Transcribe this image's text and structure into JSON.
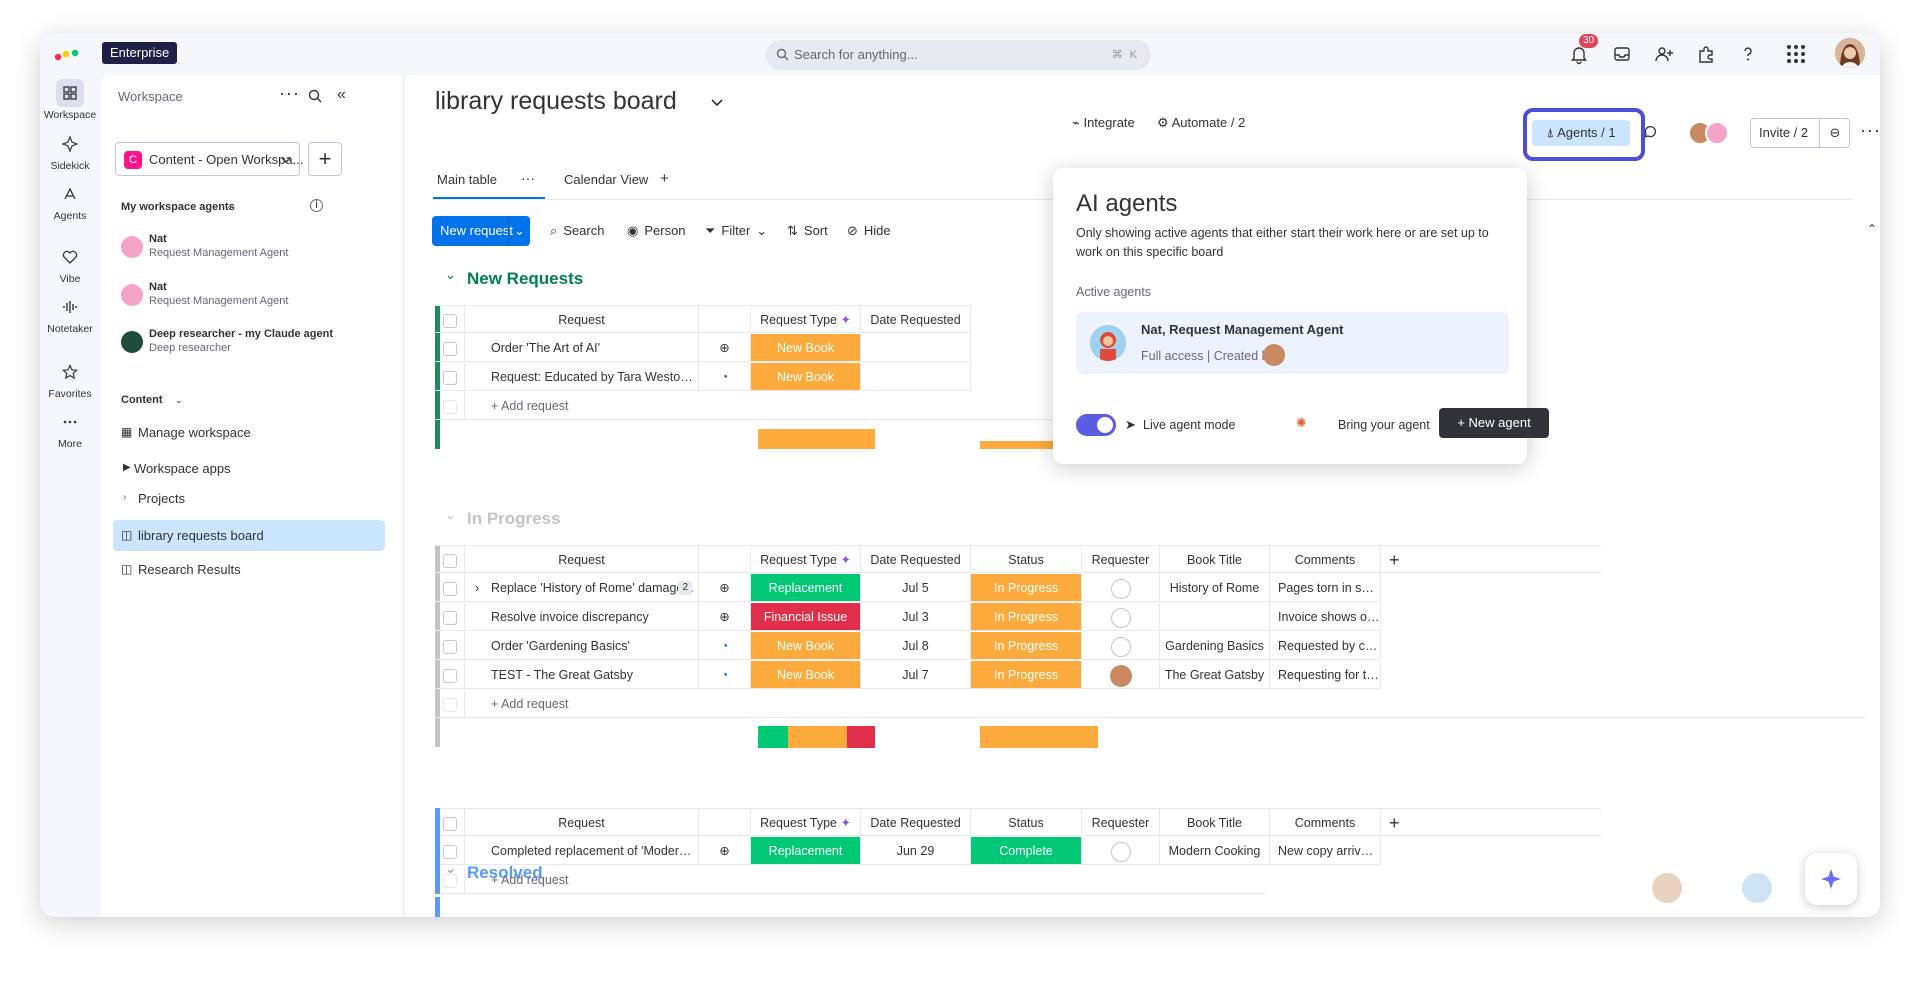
{
  "topbar": {
    "enterprise": "Enterprise",
    "search_placeholder": "Search for anything...",
    "search_shortcut": "⌘ K",
    "notif_count": "30"
  },
  "rail": [
    {
      "label": "Workspace"
    },
    {
      "label": "Sidekick"
    },
    {
      "label": "Agents"
    },
    {
      "label": "Vibe"
    },
    {
      "label": "Notetaker"
    },
    {
      "label": "Favorites"
    },
    {
      "label": "More"
    }
  ],
  "sidebar": {
    "title": "Workspace",
    "workspace_name": "Content - Open Workspa...",
    "workspace_initial": "C",
    "agents_header": "My workspace agents",
    "agents": [
      {
        "name": "Nat",
        "role": "Request Management Agent"
      },
      {
        "name": "Nat",
        "role": "Request Management Agent"
      },
      {
        "name": "Deep researcher - my Claude agent",
        "role": "Deep researcher"
      }
    ],
    "content_header": "Content",
    "items": [
      "Manage workspace",
      "Workspace apps",
      "Projects",
      "library requests board",
      "Research Results"
    ]
  },
  "board": {
    "title": "library requests board",
    "tabs": [
      "Main table",
      "Calendar View",
      "+"
    ],
    "top_actions": {
      "integrate": "Integrate",
      "automate": "Automate / 2",
      "agents": "Agents / 1",
      "invite": "Invite / 2"
    },
    "toolbar": {
      "new_request": "New request",
      "search": "Search",
      "person": "Person",
      "filter": "Filter",
      "sort": "Sort",
      "hide": "Hide"
    },
    "columns": [
      "Request",
      "Request Type",
      "Date Requested",
      "Status",
      "Requester",
      "Book Title",
      "Comments"
    ],
    "add_item": "+ Add request",
    "groups": [
      {
        "name": "New Requests",
        "color": "#037f4c",
        "rows": [
          {
            "request": "Order 'The Art of AI'",
            "type": "New Book"
          },
          {
            "request": "Request: Educated by Tara Westover ...",
            "type": "New Book"
          }
        ]
      },
      {
        "name": "In Progress",
        "color": "#c4c4c4",
        "rows": [
          {
            "request": "Replace 'History of Rome' damage...",
            "sub": "2",
            "type": "Replacement",
            "date": "Jul 5",
            "status": "In Progress",
            "title": "History of Rome",
            "comment": "Pages torn in seve..."
          },
          {
            "request": "Resolve invoice discrepancy",
            "type": "Financial Issue",
            "date": "Jul 3",
            "status": "In Progress",
            "title": "",
            "comment": "Invoice shows ov..."
          },
          {
            "request": "Order 'Gardening Basics'",
            "type": "New Book",
            "date": "Jul 8",
            "status": "In Progress",
            "title": "Gardening Basics",
            "comment": "Requested by co..."
          },
          {
            "request": "TEST - The Great Gatsby",
            "type": "New Book",
            "date": "Jul 7",
            "status": "In Progress",
            "title": "The Great Gatsby",
            "comment": "Requesting for th..."
          }
        ]
      },
      {
        "name": "Resolved",
        "color": "#579bfc",
        "rows": [
          {
            "request": "Completed replacement of 'Modern C...",
            "type": "Replacement",
            "date": "Jun 29",
            "status": "Complete",
            "title": "Modern Cooking",
            "comment": "New copy arrived ..."
          }
        ]
      }
    ]
  },
  "popup": {
    "title": "AI agents",
    "desc": "Only showing active agents that either start their work here or are set up to work on this specific board",
    "active_label": "Active agents",
    "agent_name": "Nat, Request Management Agent",
    "agent_meta": "Full access | Created by",
    "live_mode": "Live agent mode",
    "bring": "Bring your agent",
    "new_agent": "New agent"
  },
  "colors": {
    "new_book": "#fdab3d",
    "replacement": "#00c875",
    "financial": "#df2f4a",
    "in_progress": "#fdab3d",
    "complete": "#00c875",
    "accent": "#0073ea"
  }
}
